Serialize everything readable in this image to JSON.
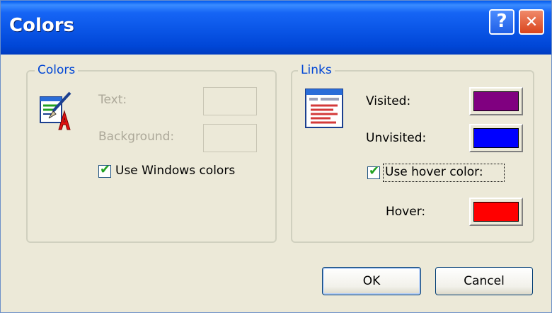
{
  "window": {
    "title": "Colors",
    "help_glyph": "?",
    "close_glyph": "✕"
  },
  "colors_group": {
    "legend": "Colors",
    "text_label": "Text:",
    "background_label": "Background:",
    "use_windows_colors_label": "Use Windows colors",
    "use_windows_colors_checked": true,
    "text_enabled": false,
    "background_enabled": false
  },
  "links_group": {
    "legend": "Links",
    "visited_label": "Visited:",
    "unvisited_label": "Unvisited:",
    "use_hover_label": "Use hover color:",
    "use_hover_checked": true,
    "hover_label": "Hover:",
    "visited_color": "#800080",
    "unvisited_color": "#0000ff",
    "hover_color": "#ff0000"
  },
  "buttons": {
    "ok_label": "OK",
    "cancel_label": "Cancel"
  },
  "icons": {
    "colors_icon": "paint-brush-letter-icon",
    "links_icon": "web-page-icon",
    "check_glyph": "✔"
  }
}
